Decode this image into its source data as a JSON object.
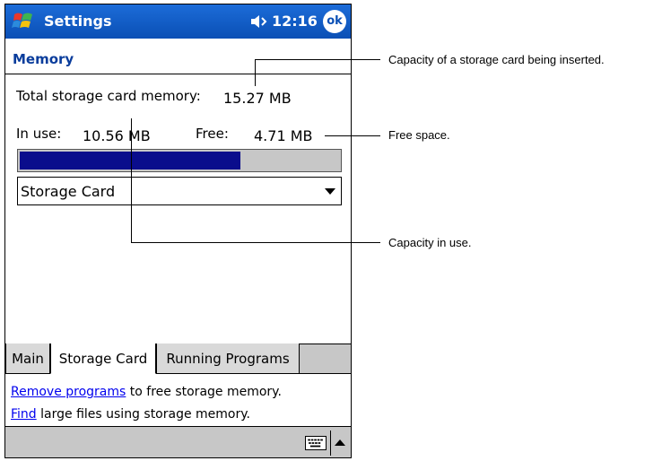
{
  "titlebar": {
    "app_title": "Settings",
    "time": "12:16",
    "ok_label": "ok"
  },
  "page": {
    "title": "Memory"
  },
  "memory": {
    "total_label": "Total storage card memory:",
    "total_value": "15.27 MB",
    "in_use_label": "In use:",
    "in_use_value": "10.56 MB",
    "free_label": "Free:",
    "free_value": "4.71 MB",
    "usage_fraction": 0.69
  },
  "dropdown": {
    "selected": "Storage Card"
  },
  "tabs": [
    {
      "label": "Main",
      "active": false
    },
    {
      "label": "Storage Card",
      "active": true
    },
    {
      "label": "Running Programs",
      "active": false
    }
  ],
  "links": {
    "remove_link": "Remove programs",
    "remove_text": " to free storage memory.",
    "find_link": "Find",
    "find_text": " large files using storage memory."
  },
  "callouts": {
    "capacity_inserted": "Capacity of a storage card being inserted.",
    "free_space": "Free space.",
    "capacity_in_use": "Capacity in use."
  },
  "colors": {
    "titlebar": "#0a4fb5",
    "progress_fill": "#0a0d8c",
    "link": "#0000ee"
  }
}
